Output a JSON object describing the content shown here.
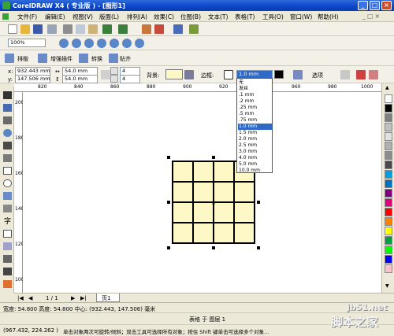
{
  "window": {
    "title": "CorelDRAW X4 ( 专业版 ) - [图形1]"
  },
  "menu": [
    "文件(F)",
    "编辑(E)",
    "视图(V)",
    "版面(L)",
    "排列(A)",
    "效果(C)",
    "位图(B)",
    "文本(T)",
    "表格(T)",
    "工具(O)",
    "窗口(W)",
    "帮助(H)"
  ],
  "zoom": {
    "value": "100%"
  },
  "table_toolbar": {
    "btn1": "排版",
    "btn2": "增强插件",
    "btn3": "转换",
    "btn4": "贴齐"
  },
  "property_bar": {
    "x": "932.443 mm",
    "y": "147.506 mm",
    "width": "54.0 mm",
    "height": "54.0 mm",
    "rows": "4",
    "cols": "4",
    "background_label": "背景:",
    "border_label": "边框:",
    "border_width": "1.0 mm",
    "options_label": "选项"
  },
  "border_dropdown": {
    "items": [
      "无",
      "发丝",
      ".1 mm",
      ".2 mm",
      ".25 mm",
      ".5 mm",
      ".75 mm",
      "1.0 mm",
      "1.5 mm",
      "2.0 mm",
      "2.5 mm",
      "3.0 mm",
      "4.0 mm",
      "5.0 mm",
      "10.0 mm"
    ],
    "selected": "1.0 mm"
  },
  "ruler": {
    "h_labels": [
      "820",
      "840",
      "860",
      "880",
      "900",
      "920",
      "940",
      "960",
      "980",
      "1000"
    ],
    "v_labels": [
      "200",
      "180",
      "160",
      "140",
      "120",
      "100"
    ]
  },
  "pagebar": {
    "page_count": "1 / 1",
    "page_tab": "页1"
  },
  "status": {
    "size": "宽度: 54.800 高度: 54.800 中心: (932.443, 147.506) 毫米",
    "object": "表格 于 图层 1",
    "coords": "(967.432, 224.262 )",
    "hint": "单击对象两次可旋转/倾斜；双击工具可选择所有对象；按住 Shift 键单击可选择多个对象..."
  },
  "watermark": {
    "site": "jb51.net",
    "brand": "脚本之家"
  },
  "colors": {
    "table_fill": "#FEF7C6",
    "selection": "#316AC5",
    "title_bar": "#0A45C8"
  },
  "palette": [
    "#FFFFFF",
    "#000000",
    "#808080",
    "#C0C0C0",
    "#E0E0E0",
    "#B0B0B0",
    "#8C8C8C",
    "#4A4A4A",
    "#00A0E0",
    "#0070C0",
    "#800080",
    "#E0007A",
    "#FF0000",
    "#FF8000",
    "#FFFF00",
    "#00A040",
    "#00FF00",
    "#0000FF",
    "#FFC0CB"
  ]
}
